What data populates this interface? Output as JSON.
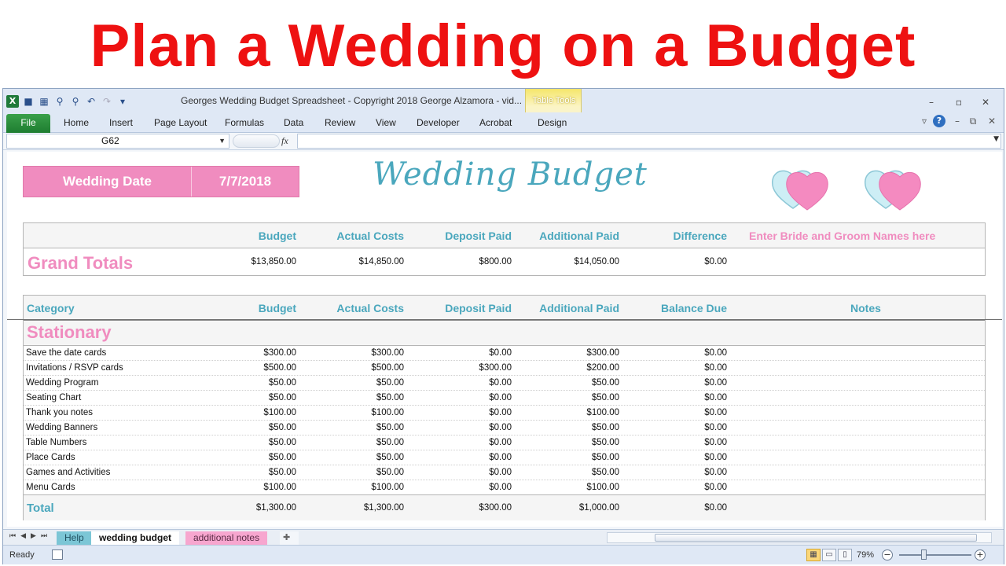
{
  "banner": {
    "title": "Plan a Wedding on a Budget"
  },
  "window": {
    "title": "Georges Wedding Budget Spreadsheet - Copyright 2018 George Alzamora - vid...",
    "contextual_group": "Table Tools"
  },
  "ribbon": {
    "file": "File",
    "tabs": [
      "Home",
      "Insert",
      "Page Layout",
      "Formulas",
      "Data",
      "Review",
      "View",
      "Developer",
      "Acrobat",
      "Design"
    ]
  },
  "formula_bar": {
    "name_box": "G62",
    "fx": "fx",
    "formula": ""
  },
  "sheet": {
    "wedding_date_label": "Wedding Date",
    "wedding_date_value": "7/7/2018",
    "title": "Wedding Budget",
    "totals": {
      "headers": [
        "Budget",
        "Actual Costs",
        "Deposit Paid",
        "Additional Paid",
        "Difference"
      ],
      "names_placeholder": "Enter Bride and Groom Names here",
      "label": "Grand Totals",
      "values": [
        "$13,850.00",
        "$14,850.00",
        "$800.00",
        "$14,050.00",
        "$0.00"
      ]
    },
    "detail": {
      "category_header": "Category",
      "headers": [
        "Budget",
        "Actual Costs",
        "Deposit Paid",
        "Additional Paid",
        "Balance Due"
      ],
      "notes_header": "Notes",
      "section": "Stationary",
      "rows": [
        {
          "label": "Save the date cards",
          "values": [
            "$300.00",
            "$300.00",
            "$0.00",
            "$300.00",
            "$0.00"
          ]
        },
        {
          "label": "Invitations / RSVP cards",
          "values": [
            "$500.00",
            "$500.00",
            "$300.00",
            "$200.00",
            "$0.00"
          ]
        },
        {
          "label": "Wedding Program",
          "values": [
            "$50.00",
            "$50.00",
            "$0.00",
            "$50.00",
            "$0.00"
          ]
        },
        {
          "label": "Seating Chart",
          "values": [
            "$50.00",
            "$50.00",
            "$0.00",
            "$50.00",
            "$0.00"
          ]
        },
        {
          "label": "Thank you notes",
          "values": [
            "$100.00",
            "$100.00",
            "$0.00",
            "$100.00",
            "$0.00"
          ]
        },
        {
          "label": "Wedding Banners",
          "values": [
            "$50.00",
            "$50.00",
            "$0.00",
            "$50.00",
            "$0.00"
          ]
        },
        {
          "label": "Table Numbers",
          "values": [
            "$50.00",
            "$50.00",
            "$0.00",
            "$50.00",
            "$0.00"
          ]
        },
        {
          "label": "Place Cards",
          "values": [
            "$50.00",
            "$50.00",
            "$0.00",
            "$50.00",
            "$0.00"
          ]
        },
        {
          "label": "Games and Activities",
          "values": [
            "$50.00",
            "$50.00",
            "$0.00",
            "$50.00",
            "$0.00"
          ]
        },
        {
          "label": "Menu Cards",
          "values": [
            "$100.00",
            "$100.00",
            "$0.00",
            "$100.00",
            "$0.00"
          ]
        }
      ],
      "total_label": "Total",
      "total_values": [
        "$1,300.00",
        "$1,300.00",
        "$300.00",
        "$1,000.00",
        "$0.00"
      ]
    }
  },
  "sheet_tabs": [
    "Help",
    "wedding budget",
    "additional notes"
  ],
  "status": {
    "ready": "Ready",
    "zoom": "79%"
  },
  "colors": {
    "pink": "#f08cbf",
    "teal": "#4aa7bd",
    "banner_red": "#ee1111",
    "excel_green": "#1f7a3a"
  },
  "icons": [
    "excel-logo-icon",
    "save-icon",
    "undo-icon",
    "redo-icon",
    "heart-icon",
    "help-icon",
    "insert-sheet-icon"
  ]
}
